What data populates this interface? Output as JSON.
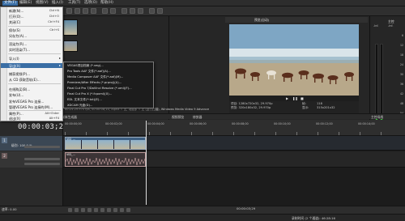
{
  "menubar": {
    "items": [
      "文件(F)",
      "编辑(E)",
      "视图(V)",
      "插入(I)",
      "工具(T)",
      "选项(O)",
      "帮助(H)"
    ]
  },
  "file_menu": {
    "items": [
      {
        "label": "新建(N)...",
        "shortcut": "Ctrl+N"
      },
      {
        "label": "打开(O)...",
        "shortcut": "Ctrl+O"
      },
      {
        "label": "关闭(C)",
        "shortcut": "Ctrl+F4"
      },
      {
        "label": "保存(S)",
        "shortcut": "Ctrl+S"
      },
      {
        "label": "另存为(A)...",
        "shortcut": ""
      },
      {
        "label": "渲染为(R)...",
        "shortcut": ""
      },
      {
        "label": "实时渲染(T)...",
        "shortcut": ""
      },
      {
        "label": "导入(I)",
        "shortcut": ""
      },
      {
        "label": "导出(X)",
        "shortcut": ""
      },
      {
        "label": "捕获视频(P)...",
        "shortcut": ""
      },
      {
        "label": "从 CD 获取音轨(E)...",
        "shortcut": ""
      },
      {
        "label": "在线购买(B)...",
        "shortcut": ""
      },
      {
        "label": "发布(U)...",
        "shortcut": ""
      },
      {
        "label": "发布VEGAS Pro 连接...",
        "shortcut": ""
      },
      {
        "label": "管理VEGAS Pro 连接的(M)...",
        "shortcut": ""
      },
      {
        "label": "属性(P)...",
        "shortcut": "Alt+Enter"
      },
      {
        "label": "退出(X)",
        "shortcut": "Alt+F4"
      }
    ]
  },
  "export_submenu": {
    "items": [
      "VEGAS项目档案 (*.veg)...",
      "Pro Tools AAF 文件(*.aaf)(A)...",
      "Media Composer AAF 文件(*.aaf)(M)...",
      "Premiere/After Effects (*.prproj)(A)...",
      "Final Cut Pro 7/DaVinci Resolve (*.xml)(F)...",
      "Final Cut Pro X (*.fcpxml)(X)...",
      "EDL 文本文件(*.txt)(E)...",
      "XDCAM 光盘(D)..."
    ]
  },
  "preview": {
    "toolbar_label": "预览(自动)",
    "info_line1_left": "项目: 1280x720x32, 29.970p",
    "info_line1_right": "帧:",
    "info_line1_value": "118",
    "info_line2_left": "预览: 320x180x32, 29.970p",
    "info_line2_right": "显示:",
    "info_line2_value": "315x201x32"
  },
  "tabs": {
    "upper_left": [
      "项目",
      "媒体",
      "资源管理器",
      "转场",
      "视频FX",
      "媒体生成器"
    ],
    "upper_right": [
      "视频预览",
      "修剪器"
    ],
    "master": "主控母线"
  },
  "master_bus": {
    "label": "主控",
    "db_values": [
      "-Inf.",
      "-Inf.",
      "6",
      "12",
      "18",
      "24",
      "30",
      "36",
      "42",
      "48",
      "54"
    ]
  },
  "timeline": {
    "timecode": "00:00:03;29",
    "ruler_labels": [
      "00:00:00;00",
      "00:00:02;00",
      "00:00:04;00",
      "00:00:06;00",
      "00:00:08;00",
      "00:00:10;00",
      "00:00:12;00",
      "00:00:14;00"
    ],
    "video_track": {
      "number": "1",
      "level_label": "级别: 100.0 %",
      "clip_name": "VID_..."
    },
    "audio_track": {
      "number": "2",
      "clip_name": "VID_..."
    },
    "end_timecode": "00:00:03;29"
  },
  "transport": {
    "rate_label": "速率: 0.00"
  },
  "status": {
    "left_text": "00:24:29.970 fps, 00:00:08;10, Alpha = 无, 场顺序 = 无 (逐行扫描), Windows Media Video 9 Advance",
    "right_text": "录制时间 (2 个通道): 46:28:16"
  },
  "colors": {
    "accent": "#3a6ea5",
    "video_clip": "#3d5f82",
    "audio_clip": "#3c3436"
  }
}
